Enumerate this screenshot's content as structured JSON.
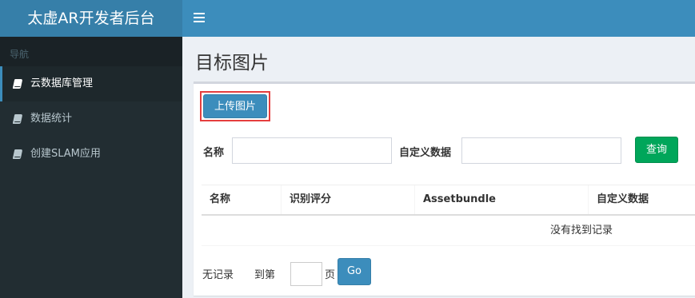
{
  "header": {
    "logo_text": "太虚AR开发者后台",
    "menu_icon": "hamburger-icon"
  },
  "sidebar": {
    "section_header": "导航",
    "items": [
      {
        "label": "云数据库管理",
        "icon": "book-icon",
        "active": true
      },
      {
        "label": "数据统计",
        "icon": "book-icon",
        "active": false
      },
      {
        "label": "创建SLAM应用",
        "icon": "book-icon",
        "active": false
      }
    ]
  },
  "main": {
    "title": "目标图片",
    "upload_label": "上传图片",
    "filters": {
      "name_label": "名称",
      "name_value": "",
      "custom_label": "自定义数据",
      "custom_value": "",
      "query_label": "查询"
    },
    "table": {
      "columns": [
        "名称",
        "识别评分",
        "Assetbundle",
        "自定义数据"
      ],
      "rows": [],
      "empty_text": "没有找到记录"
    },
    "pagination": {
      "no_records": "无记录",
      "goto_prefix": "到第",
      "page_value": "",
      "goto_suffix": "页",
      "go_label": "Go"
    }
  },
  "colors": {
    "header": "#3c8dbc",
    "logo_bg": "#367fa9",
    "sidebar": "#222d32",
    "query_button": "#00a65a",
    "highlight_border": "#e53e3e"
  }
}
